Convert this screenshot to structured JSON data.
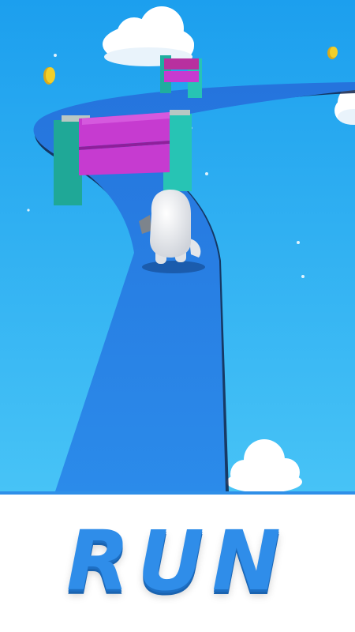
{
  "screen": {
    "caption": "RUN"
  },
  "colors": {
    "sky_top": "#1fa3ee",
    "sky_bottom": "#4cc6f5",
    "track": "#2b86e6",
    "track_dark": "#1a66c5",
    "barrier_pink": "#c63bd0",
    "barrier_post": "#27c4b4",
    "coin": "#f2cf2a",
    "caption": "#2f8de9"
  },
  "scene_objects": {
    "character": "white-blob-runner",
    "obstacles": [
      "barrier-near",
      "barrier-far"
    ],
    "coins": 2,
    "clouds": 3
  }
}
